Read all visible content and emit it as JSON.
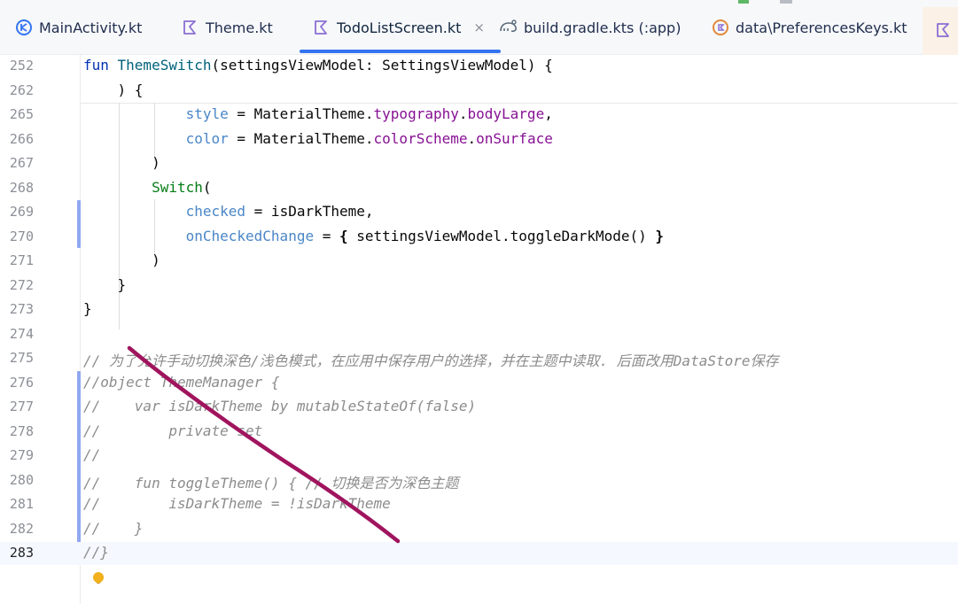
{
  "tabs": [
    {
      "label": "MainActivity.kt",
      "icon": "kotlin-class-icon",
      "active": false
    },
    {
      "label": "Theme.kt",
      "icon": "kotlin-file-icon",
      "active": false
    },
    {
      "label": "TodoListScreen.kt",
      "icon": "kotlin-file-icon",
      "active": true,
      "close": "×"
    },
    {
      "label": "build.gradle.kts (:app)",
      "icon": "gradle-icon",
      "active": false
    },
    {
      "label": "data\\PreferencesKeys.kt",
      "icon": "kotlin-object-icon",
      "active": false
    }
  ],
  "colors": {
    "accent": "#3574f0",
    "keyword": "#0033b3",
    "function": "#00627a",
    "property": "#871094",
    "named_arg": "#4a86c7",
    "call": "#067d17",
    "comment": "#8c8c8c",
    "annotation_stroke": "#a0145e",
    "bulb": "#f2b01e"
  },
  "lines": [
    {
      "num": "252",
      "segs": [
        [
          "kw",
          "fun "
        ],
        [
          "fn",
          "ThemeSwitch"
        ],
        [
          "plain",
          "(settingsViewModel: SettingsViewModel) {"
        ]
      ]
    },
    {
      "num": "262",
      "segs": [
        [
          "plain",
          "    ) {"
        ]
      ]
    },
    {
      "num": "265",
      "segs": [
        [
          "plain",
          "            "
        ],
        [
          "named",
          "style"
        ],
        [
          "plain",
          " = MaterialTheme."
        ],
        [
          "prop",
          "typography"
        ],
        [
          "plain",
          "."
        ],
        [
          "prop",
          "bodyLarge"
        ],
        [
          "plain",
          ","
        ]
      ]
    },
    {
      "num": "266",
      "segs": [
        [
          "plain",
          "            "
        ],
        [
          "named",
          "color"
        ],
        [
          "plain",
          " = MaterialTheme."
        ],
        [
          "prop",
          "colorScheme"
        ],
        [
          "plain",
          "."
        ],
        [
          "prop",
          "onSurface"
        ]
      ]
    },
    {
      "num": "267",
      "segs": [
        [
          "plain",
          "        )"
        ]
      ]
    },
    {
      "num": "268",
      "segs": [
        [
          "plain",
          "        "
        ],
        [
          "call",
          "Switch"
        ],
        [
          "plain",
          "("
        ]
      ]
    },
    {
      "num": "269",
      "segs": [
        [
          "plain",
          "            "
        ],
        [
          "named",
          "checked"
        ],
        [
          "plain",
          " = isDarkTheme,"
        ]
      ]
    },
    {
      "num": "270",
      "segs": [
        [
          "plain",
          "            "
        ],
        [
          "named",
          "onCheckedChange"
        ],
        [
          "plain",
          " = "
        ],
        [
          "bold",
          "{"
        ],
        [
          "plain",
          " settingsViewModel.toggleDarkMode() "
        ],
        [
          "bold",
          "}"
        ]
      ]
    },
    {
      "num": "271",
      "segs": [
        [
          "plain",
          "        )"
        ]
      ]
    },
    {
      "num": "272",
      "segs": [
        [
          "plain",
          "    }"
        ]
      ]
    },
    {
      "num": "273",
      "segs": [
        [
          "plain",
          "}"
        ]
      ]
    },
    {
      "num": "274",
      "segs": [
        [
          "plain",
          ""
        ]
      ]
    },
    {
      "num": "275",
      "segs": [
        [
          "comment",
          "// 为了允许手动切换深色/浅色模式，在应用中保存用户的选择，并在主题中读取. 后面改用DataStore保存"
        ]
      ]
    },
    {
      "num": "276",
      "segs": [
        [
          "comment",
          "//object ThemeManager {"
        ]
      ]
    },
    {
      "num": "277",
      "segs": [
        [
          "comment",
          "//    var isDarkTheme by mutableStateOf(false)"
        ]
      ]
    },
    {
      "num": "278",
      "segs": [
        [
          "comment",
          "//        private set"
        ]
      ]
    },
    {
      "num": "279",
      "segs": [
        [
          "comment",
          "//"
        ]
      ]
    },
    {
      "num": "280",
      "segs": [
        [
          "comment",
          "//    fun toggleTheme() { // 切换是否为深色主题"
        ]
      ]
    },
    {
      "num": "281",
      "segs": [
        [
          "comment",
          "//        isDarkTheme = !isDarkTheme"
        ]
      ]
    },
    {
      "num": "282",
      "segs": [
        [
          "comment",
          "//    }"
        ]
      ]
    },
    {
      "num": "283",
      "segs": [
        [
          "comment",
          "//}"
        ]
      ]
    }
  ]
}
